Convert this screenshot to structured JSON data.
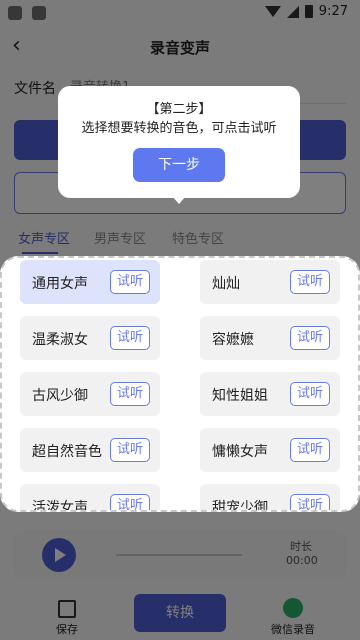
{
  "status": {
    "time": "9:27"
  },
  "header": {
    "title": "录音变声"
  },
  "file": {
    "label": "文件名",
    "placeholder": "录音转换1"
  },
  "import_button": "上传文件 / 导入文件",
  "voice_tabs": [
    "女声专区",
    "男声专区",
    "特色专区"
  ],
  "voices": [
    {
      "name": "通用女声",
      "try": "试听",
      "selected": true
    },
    {
      "name": "灿灿",
      "try": "试听",
      "selected": false
    },
    {
      "name": "温柔淑女",
      "try": "试听",
      "selected": false
    },
    {
      "name": "容嬷嬷",
      "try": "试听",
      "selected": false
    },
    {
      "name": "古风少御",
      "try": "试听",
      "selected": false
    },
    {
      "name": "知性姐姐",
      "try": "试听",
      "selected": false
    },
    {
      "name": "超自然音色",
      "try": "试听",
      "selected": false
    },
    {
      "name": "慵懒女声",
      "try": "试听",
      "selected": false
    },
    {
      "name": "活泼女声",
      "try": "试听",
      "selected": false
    },
    {
      "name": "甜宠少御",
      "try": "试听",
      "selected": false
    }
  ],
  "player": {
    "duration_label": "时长",
    "duration_value": "00:00"
  },
  "bottom": {
    "save_label": "保存",
    "convert_label": "转换",
    "wechat_label": "微信录音"
  },
  "guide": {
    "step": "【第二步】",
    "text": "选择想要转换的音色，可点击试听",
    "next_label": "下一步"
  },
  "colors": {
    "accent": "#4c5fd5",
    "guide_button": "#5e79ef",
    "selected_bg": "#dde3fb",
    "wechat": "#2aae67"
  }
}
